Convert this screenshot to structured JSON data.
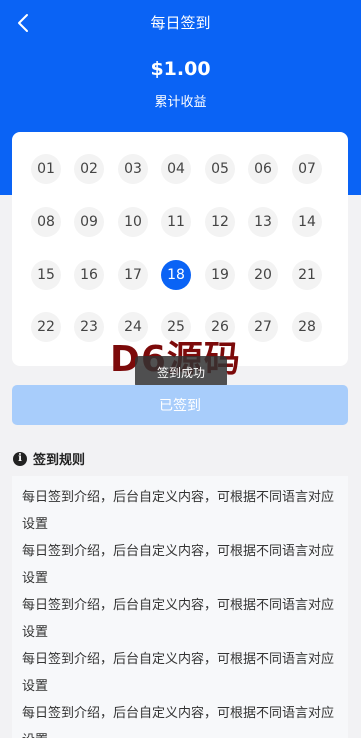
{
  "header": {
    "title": "每日签到",
    "amount": "$1.00",
    "amount_label": "累计收益"
  },
  "calendar": {
    "days": [
      "01",
      "02",
      "03",
      "04",
      "05",
      "06",
      "07",
      "08",
      "09",
      "10",
      "11",
      "12",
      "13",
      "14",
      "15",
      "16",
      "17",
      "18",
      "19",
      "20",
      "21",
      "22",
      "23",
      "24",
      "25",
      "26",
      "27",
      "28"
    ],
    "active_day": "18"
  },
  "toast": "签到成功",
  "watermark": "D6源码",
  "signed_button": "已签到",
  "rules": {
    "title": "签到规则",
    "lines": [
      "每日签到介绍，后台自定义内容，可根据不同语言对应设置",
      "每日签到介绍，后台自定义内容，可根据不同语言对应设置",
      "每日签到介绍，后台自定义内容，可根据不同语言对应设置",
      "每日签到介绍，后台自定义内容，可根据不同语言对应设置",
      "每日签到介绍，后台自定义内容，可根据不同语言对应设置"
    ]
  },
  "colors": {
    "primary": "#0a63f5",
    "signed_button": "#a8cdfb"
  }
}
